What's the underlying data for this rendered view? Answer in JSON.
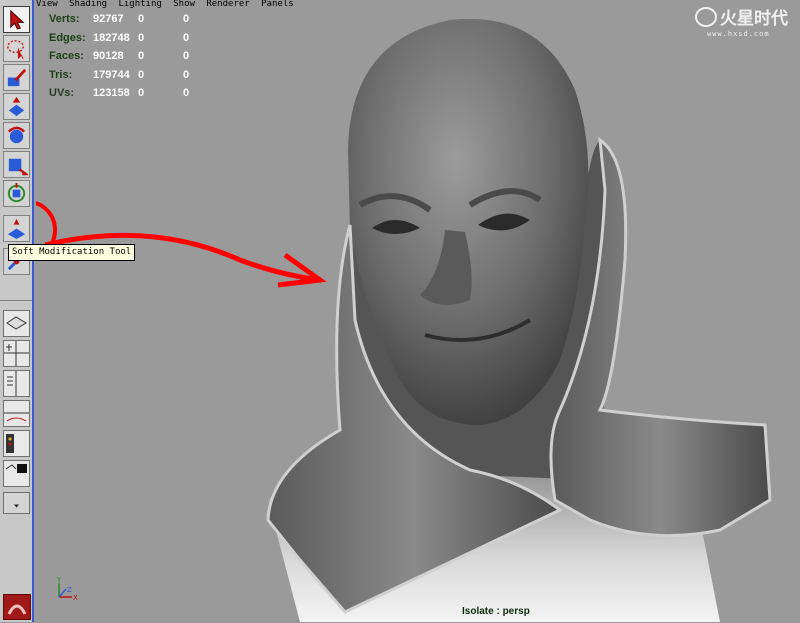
{
  "menubar": [
    "View",
    "Shading",
    "Lighting",
    "Show",
    "Renderer",
    "Panels"
  ],
  "hud": [
    {
      "label": "Verts:",
      "value": "92767",
      "sel": "0",
      "comp": "0"
    },
    {
      "label": "Edges:",
      "value": "182748",
      "sel": "0",
      "comp": "0"
    },
    {
      "label": "Faces:",
      "value": "90128",
      "sel": "0",
      "comp": "0"
    },
    {
      "label": "Tris:",
      "value": "179744",
      "sel": "0",
      "comp": "0"
    },
    {
      "label": "UVs:",
      "value": "123158",
      "sel": "0",
      "comp": "0"
    }
  ],
  "tooltip": "Soft Modification Tool",
  "isolate_label": "Isolate : persp",
  "watermark": {
    "logo_text": "火星时代",
    "url": "www.hxsd.com"
  },
  "axis": {
    "x": "X",
    "y": "Y",
    "z": "Z"
  },
  "tools": [
    {
      "name": "select-tool",
      "icon": "arrow-icon"
    },
    {
      "name": "lasso-tool",
      "icon": "lasso-icon"
    },
    {
      "name": "paint-select-tool",
      "icon": "paint-brush-icon"
    },
    {
      "name": "move-tool",
      "icon": "move-icon"
    },
    {
      "name": "rotate-tool",
      "icon": "rotate-icon"
    },
    {
      "name": "scale-tool",
      "icon": "scale-icon"
    },
    {
      "name": "universal-manipulator-tool",
      "icon": "universal-manip-icon"
    },
    {
      "name": "soft-modification-tool",
      "icon": "soft-mod-icon"
    },
    {
      "name": "show-manipulator-tool",
      "icon": "show-manip-icon"
    }
  ],
  "colors": {
    "viewport_bg": "#9a9a9a",
    "annotation": "#ff0000",
    "hud_text": "#ffffff",
    "hud_label": "#1e3f18",
    "toolbox_border": "#3a5bd0"
  }
}
